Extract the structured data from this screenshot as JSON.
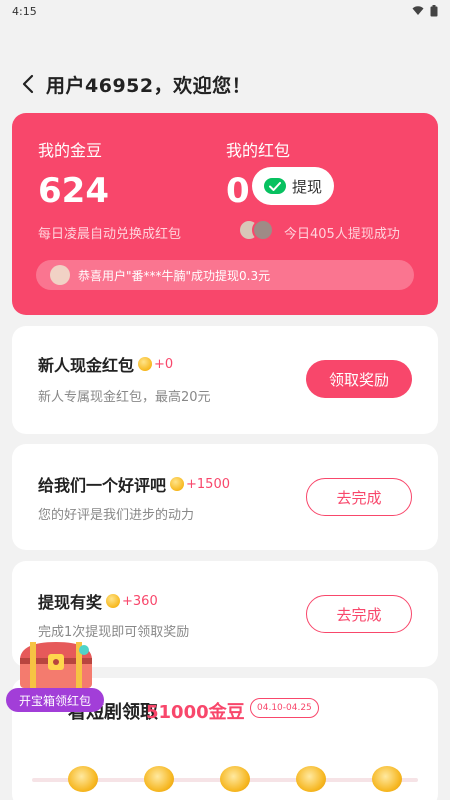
{
  "status_bar": {
    "time": "4:15"
  },
  "header": {
    "title": "用户46952，欢迎您！"
  },
  "hero": {
    "beans_label": "我的金豆",
    "beans_value": "624",
    "beans_note": "每日凌晨自动兑换成红包",
    "redpacket_label": "我的红包",
    "redpacket_value": "0",
    "withdraw_label": "提现",
    "today_note": "今日405人提现成功",
    "ticker": "恭喜用户\"番***牛腩\"成功提现0.3元"
  },
  "tasks": [
    {
      "title": "新人现金红包",
      "reward": "+0",
      "desc": "新人专属现金红包，最高20元",
      "button": "领取奖励"
    },
    {
      "title": "给我们一个好评吧",
      "reward": "+1500",
      "desc": "您的好评是我们进步的动力",
      "button": "去完成"
    },
    {
      "title": "提现有奖",
      "reward": "+360",
      "desc": "完成1次提现即可领取奖励",
      "button": "去完成"
    }
  ],
  "claim": {
    "title": "看短剧领取",
    "amount": "51000金豆",
    "dates": "04.10-04.25"
  },
  "chest": {
    "label": "开宝箱领红包"
  },
  "colors": {
    "accent": "#f8476b",
    "chest_purple": "#a23ed8",
    "wechat_green": "#07c160"
  }
}
